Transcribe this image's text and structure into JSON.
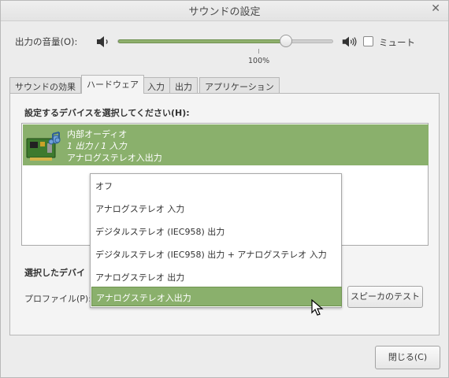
{
  "window": {
    "title": "サウンドの設定"
  },
  "output": {
    "label": "出力の音量(O):",
    "level": 0.78,
    "percent_label": "100%",
    "mute_label": "ミュート",
    "muted": false
  },
  "tabs": [
    {
      "label": "サウンドの効果"
    },
    {
      "label": "ハードウェア",
      "active": true
    },
    {
      "label": "入力"
    },
    {
      "label": "出力"
    },
    {
      "label": "アプリケーション"
    }
  ],
  "hardware": {
    "device_heading": "設定するデバイスを選択してください(H):",
    "device": {
      "name": "内部オーディオ",
      "ports": "1 出力 / 1 入力",
      "profile": "アナログステレオ入出力"
    },
    "selected_device_label": "選択したデバイ",
    "profile_label": "プロファイル(P):",
    "test_button": "スピーカのテスト"
  },
  "profile_dropdown": {
    "options": [
      "オフ",
      "アナログステレオ 入力",
      "デジタルステレオ (IEC958) 出力",
      "デジタルステレオ (IEC958) 出力 + アナログステレオ 入力",
      "アナログステレオ 出力",
      "アナログステレオ入出力"
    ],
    "selected_index": 5
  },
  "footer": {
    "close_button": "閉じる(C)"
  },
  "colors": {
    "accent": "#8ab06c",
    "accent_border": "#6f9350"
  }
}
